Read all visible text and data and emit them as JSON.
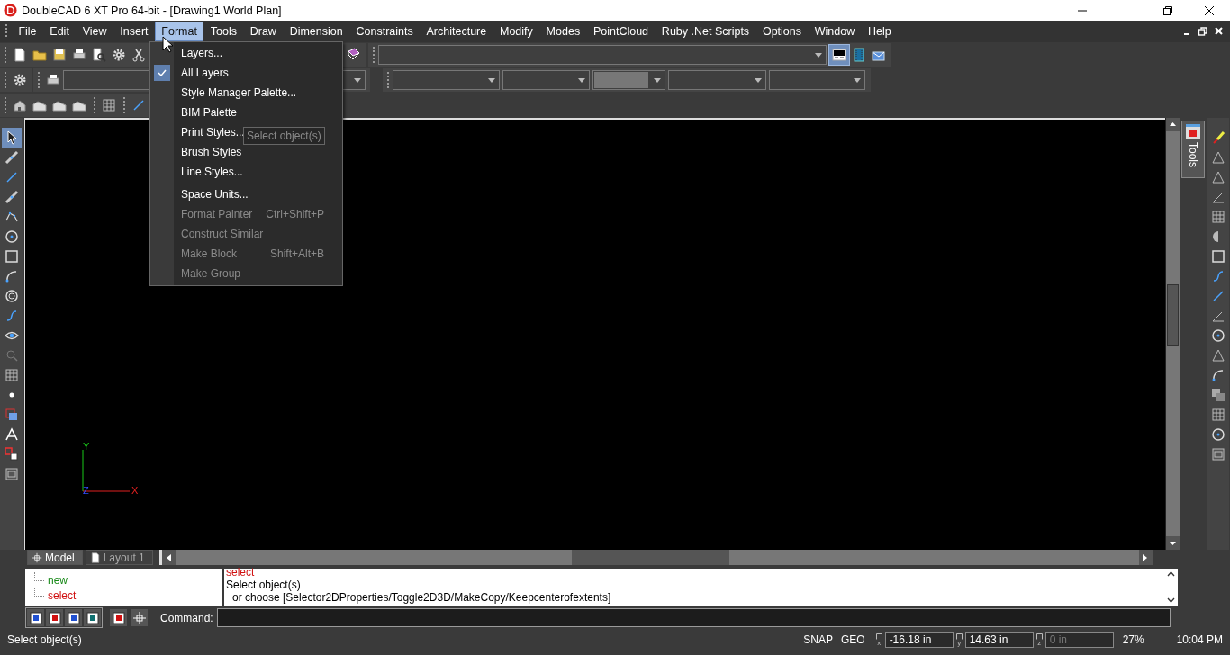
{
  "window": {
    "title": "DoubleCAD 6 XT Pro 64-bit - [Drawing1 World Plan]"
  },
  "menu_bar": [
    {
      "label": "File",
      "selected": false
    },
    {
      "label": "Edit",
      "selected": false
    },
    {
      "label": "View",
      "selected": false
    },
    {
      "label": "Insert",
      "selected": false
    },
    {
      "label": "Format",
      "selected": true
    },
    {
      "label": "Tools",
      "selected": false
    },
    {
      "label": "Draw",
      "selected": false
    },
    {
      "label": "Dimension",
      "selected": false
    },
    {
      "label": "Constraints",
      "selected": false
    },
    {
      "label": "Architecture",
      "selected": false
    },
    {
      "label": "Modify",
      "selected": false
    },
    {
      "label": "Modes",
      "selected": false
    },
    {
      "label": "PointCloud",
      "selected": false
    },
    {
      "label": "Ruby .Net Scripts",
      "selected": false
    },
    {
      "label": "Options",
      "selected": false
    },
    {
      "label": "Window",
      "selected": false
    },
    {
      "label": "Help",
      "selected": false
    }
  ],
  "format_menu": [
    {
      "label": "Layers...",
      "checked": false,
      "disabled": false
    },
    {
      "label": "All Layers",
      "checked": true,
      "disabled": false
    },
    {
      "label": "Style Manager Palette...",
      "checked": false,
      "disabled": false
    },
    {
      "label": "BIM Palette",
      "checked": false,
      "disabled": false
    },
    {
      "label": "Print Styles...",
      "checked": false,
      "disabled": false
    },
    {
      "label": "Brush Styles",
      "checked": false,
      "disabled": false
    },
    {
      "label": "Line Styles...",
      "checked": false,
      "disabled": false
    },
    {
      "label": "Space Units...",
      "checked": false,
      "disabled": false
    },
    {
      "label": "Format Painter",
      "shortcut": "Ctrl+Shift+P",
      "checked": false,
      "disabled": true
    },
    {
      "label": "Construct Similar",
      "checked": false,
      "disabled": true
    },
    {
      "label": "Make Block",
      "shortcut": "Shift+Alt+B",
      "checked": false,
      "disabled": true
    },
    {
      "label": "Make Group",
      "checked": false,
      "disabled": true
    }
  ],
  "tooltip": "Select object(s)",
  "axes": {
    "x": "X",
    "y": "Y",
    "z": "Z"
  },
  "palette_tab": "Tools",
  "layout_tabs": [
    {
      "label": "Model",
      "selected": true
    },
    {
      "label": "Layout 1",
      "selected": false
    }
  ],
  "command_tree": [
    {
      "label": "new",
      "color": "#1a8a1a"
    },
    {
      "label": "select",
      "color": "#d01010"
    }
  ],
  "command_history": [
    {
      "text": "select",
      "color": "#d01010"
    },
    {
      "text": "Select object(s)",
      "color": "#000000"
    },
    {
      "text": "or choose [Selector2DProperties/Toggle2D3D/MakeCopy/Keepcenterofextents]",
      "color": "#000000"
    }
  ],
  "command_line": {
    "label": "Command:"
  },
  "status_bar": {
    "message": "Select object(s)",
    "toggles": [
      "SNAP",
      "GEO"
    ],
    "coordinates": [
      {
        "axis": "x",
        "value": "-16.18 in",
        "disabled": false
      },
      {
        "axis": "y",
        "value": "14.63 in",
        "disabled": false
      },
      {
        "axis": "z",
        "value": "0 in",
        "disabled": true
      }
    ],
    "zoom": "27%",
    "time": "10:04 PM"
  }
}
